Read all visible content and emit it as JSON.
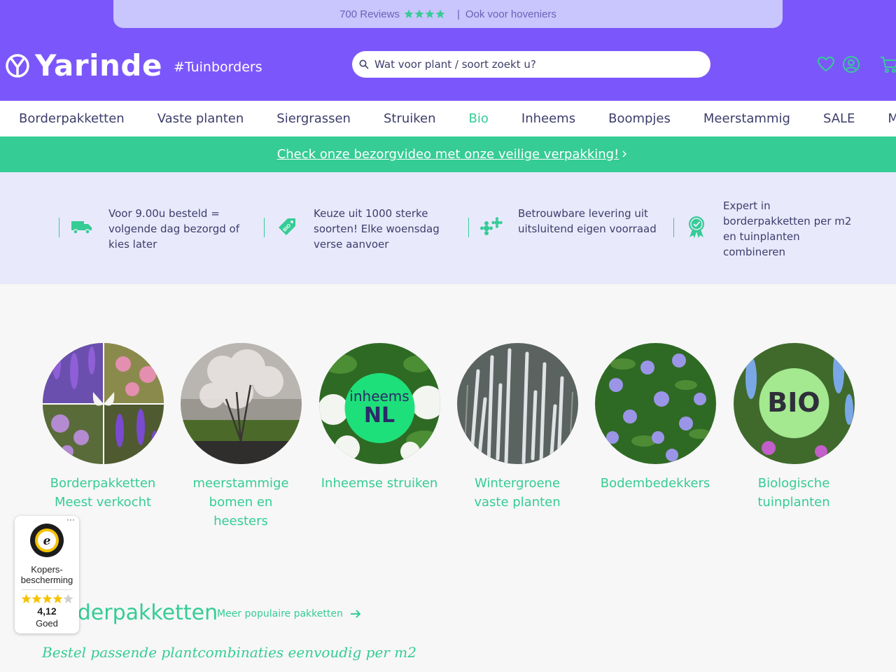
{
  "topbar": {
    "reviews": "700 Reviews",
    "separator": "|",
    "hoveniers": "Ook voor hoveniers"
  },
  "brand": {
    "name": "Yarinde",
    "tagline": "#Tuinborders"
  },
  "search": {
    "placeholder": "Wat voor plant / soort zoekt u?"
  },
  "header_icons": [
    "heart-icon",
    "account-icon",
    "cart-icon"
  ],
  "nav": {
    "items": [
      "Borderpakketten",
      "Vaste planten",
      "Siergrassen",
      "Struiken",
      "Bio",
      "Inheems",
      "Boompjes",
      "Meerstammig",
      "SALE"
    ],
    "active": "Bio",
    "more": "Meer"
  },
  "promo": {
    "text": "Check onze bezorgvideo met onze veilige verpakking!"
  },
  "usps": [
    {
      "icon": "truck-icon",
      "text": "Voor 9.00u besteld = volgende dag bezorgd of kies later"
    },
    {
      "icon": "bio-tag-icon",
      "text": "Keuze uit 1000 sterke soorten! Elke woensdag verse aanvoer"
    },
    {
      "icon": "flowers-icon",
      "text": "Betrouwbare levering uit uitsluitend eigen voorraad"
    },
    {
      "icon": "award-icon",
      "text": "Expert in borderpakketten per m2 en tuinplanten combineren"
    }
  ],
  "categories": [
    {
      "label": "Borderpakketten Meest verkocht"
    },
    {
      "label": "meerstammige bomen en heesters"
    },
    {
      "label": "Inheemse struiken",
      "badge_top": "inheems",
      "badge_bottom": "NL"
    },
    {
      "label": "Wintergroene vaste planten"
    },
    {
      "label": "Bodembedekkers"
    },
    {
      "label": "Biologische tuinplanten",
      "badge": "BIO"
    }
  ],
  "trusted_shops": {
    "menu": "···",
    "label": "Kopers-bescherming",
    "score": "4,12",
    "rating_text": "Goed",
    "stars": 4.12
  },
  "section": {
    "title": "Borderpakketten",
    "link": "Meer populaire pakketten",
    "subtitle": "Bestel passende plantcombinaties eenvoudig per m2"
  },
  "colors": {
    "brand_purple": "#7b57fb",
    "accent_green": "#35cc95",
    "text_navy": "#3d3d6b",
    "usp_bg": "#e9e9fc"
  }
}
